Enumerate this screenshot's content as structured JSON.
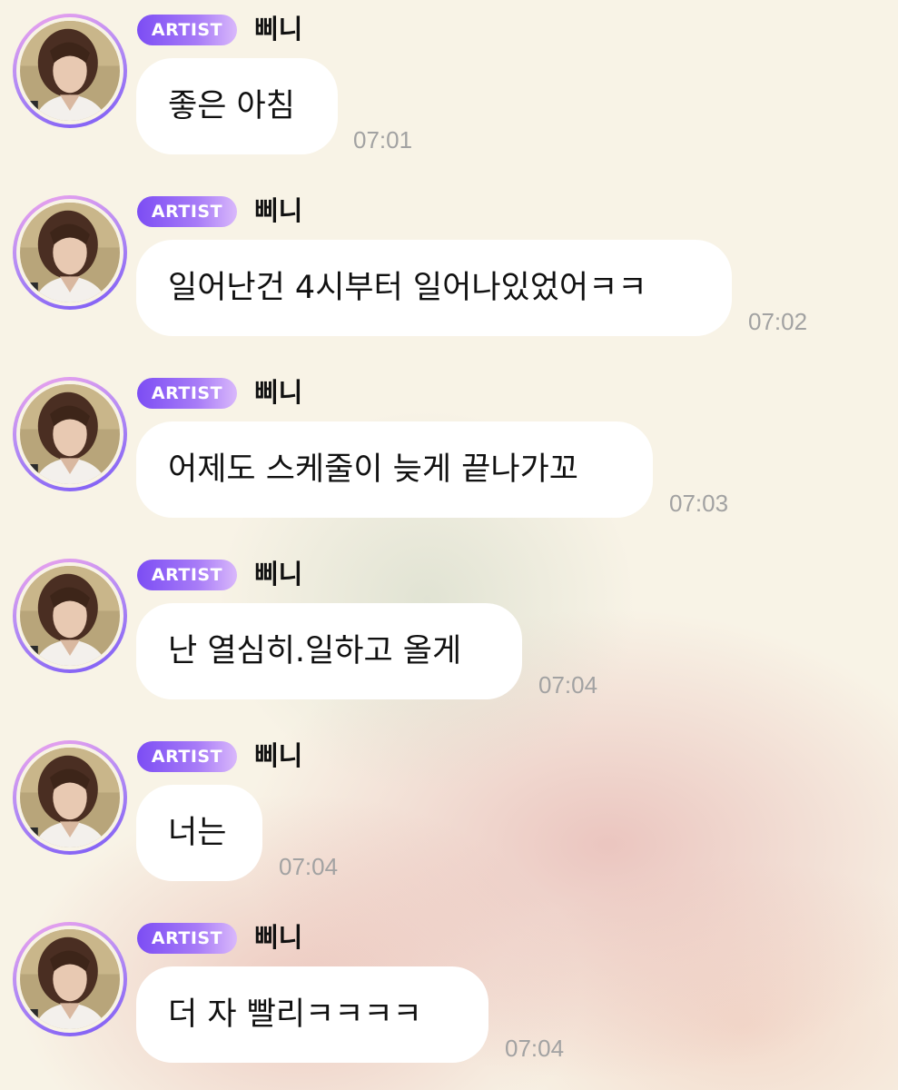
{
  "colors": {
    "background": "#f8f3e6",
    "badge_gradient_start": "#7c4df4",
    "badge_gradient_end": "#d9b8fb",
    "bubble": "#ffffff",
    "timestamp": "#a2a2a2",
    "avatar_ring": "#b58cf4"
  },
  "messages": [
    {
      "badge": "ARTIST",
      "sender": "삐니",
      "text": "좋은 아침",
      "time": "07:01",
      "avatar_icon": "artist-profile-photo"
    },
    {
      "badge": "ARTIST",
      "sender": "삐니",
      "text": "일어난건 4시부터 일어나있었어ㅋㅋ",
      "time": "07:02",
      "avatar_icon": "artist-profile-photo"
    },
    {
      "badge": "ARTIST",
      "sender": "삐니",
      "text": "어제도 스케줄이 늦게 끝나가꼬",
      "time": "07:03",
      "avatar_icon": "artist-profile-photo"
    },
    {
      "badge": "ARTIST",
      "sender": "삐니",
      "text": "난 열심히.일하고 올게",
      "time": "07:04",
      "avatar_icon": "artist-profile-photo"
    },
    {
      "badge": "ARTIST",
      "sender": "삐니",
      "text": "너는",
      "time": "07:04",
      "avatar_icon": "artist-profile-photo"
    },
    {
      "badge": "ARTIST",
      "sender": "삐니",
      "text": "더 자 빨리ㅋㅋㅋㅋ",
      "time": "07:04",
      "avatar_icon": "artist-profile-photo"
    }
  ]
}
